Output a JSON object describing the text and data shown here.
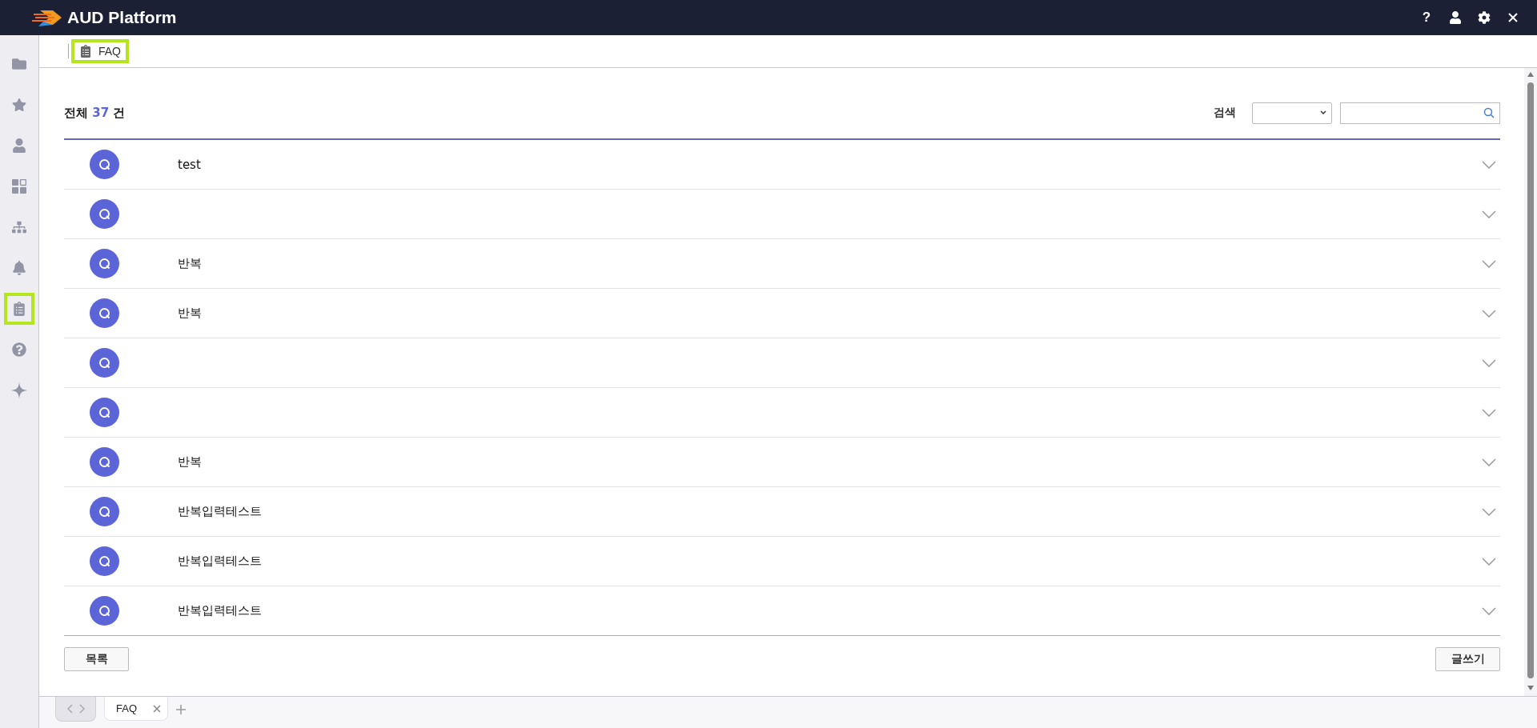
{
  "app": {
    "title": "AUD Platform"
  },
  "header_actions": [
    {
      "label": "?"
    }
  ],
  "sidebar": {
    "items": [
      {
        "selected": false
      },
      {
        "selected": false
      },
      {
        "selected": false
      },
      {
        "selected": false
      },
      {
        "selected": false
      },
      {
        "selected": false
      },
      {
        "selected": true
      },
      {
        "selected": false
      },
      {
        "selected": false
      }
    ]
  },
  "breadcrumb": {
    "label": "FAQ",
    "selected": true
  },
  "summary": {
    "prefix": "전체",
    "count": "37",
    "suffix": "건"
  },
  "search": {
    "label": "검색"
  },
  "faq": [
    {
      "question": "test",
      "expanded": false
    },
    {
      "expanded": false
    },
    {
      "question": "반복",
      "expanded": false
    },
    {
      "question": "반복",
      "expanded": false
    },
    {
      "expanded": false
    },
    {
      "expanded": false
    },
    {
      "question": "반복",
      "expanded": false
    },
    {
      "question": "반복입력테스트",
      "expanded": false
    },
    {
      "question": "반복입력테스트",
      "expanded": false
    },
    {
      "question": "반복입력테스트",
      "expanded": false
    }
  ],
  "buttons": {
    "list": "목록",
    "write": "글쓰기"
  },
  "bottom_tabs": [
    {
      "label": "FAQ",
      "selected": true
    }
  ]
}
